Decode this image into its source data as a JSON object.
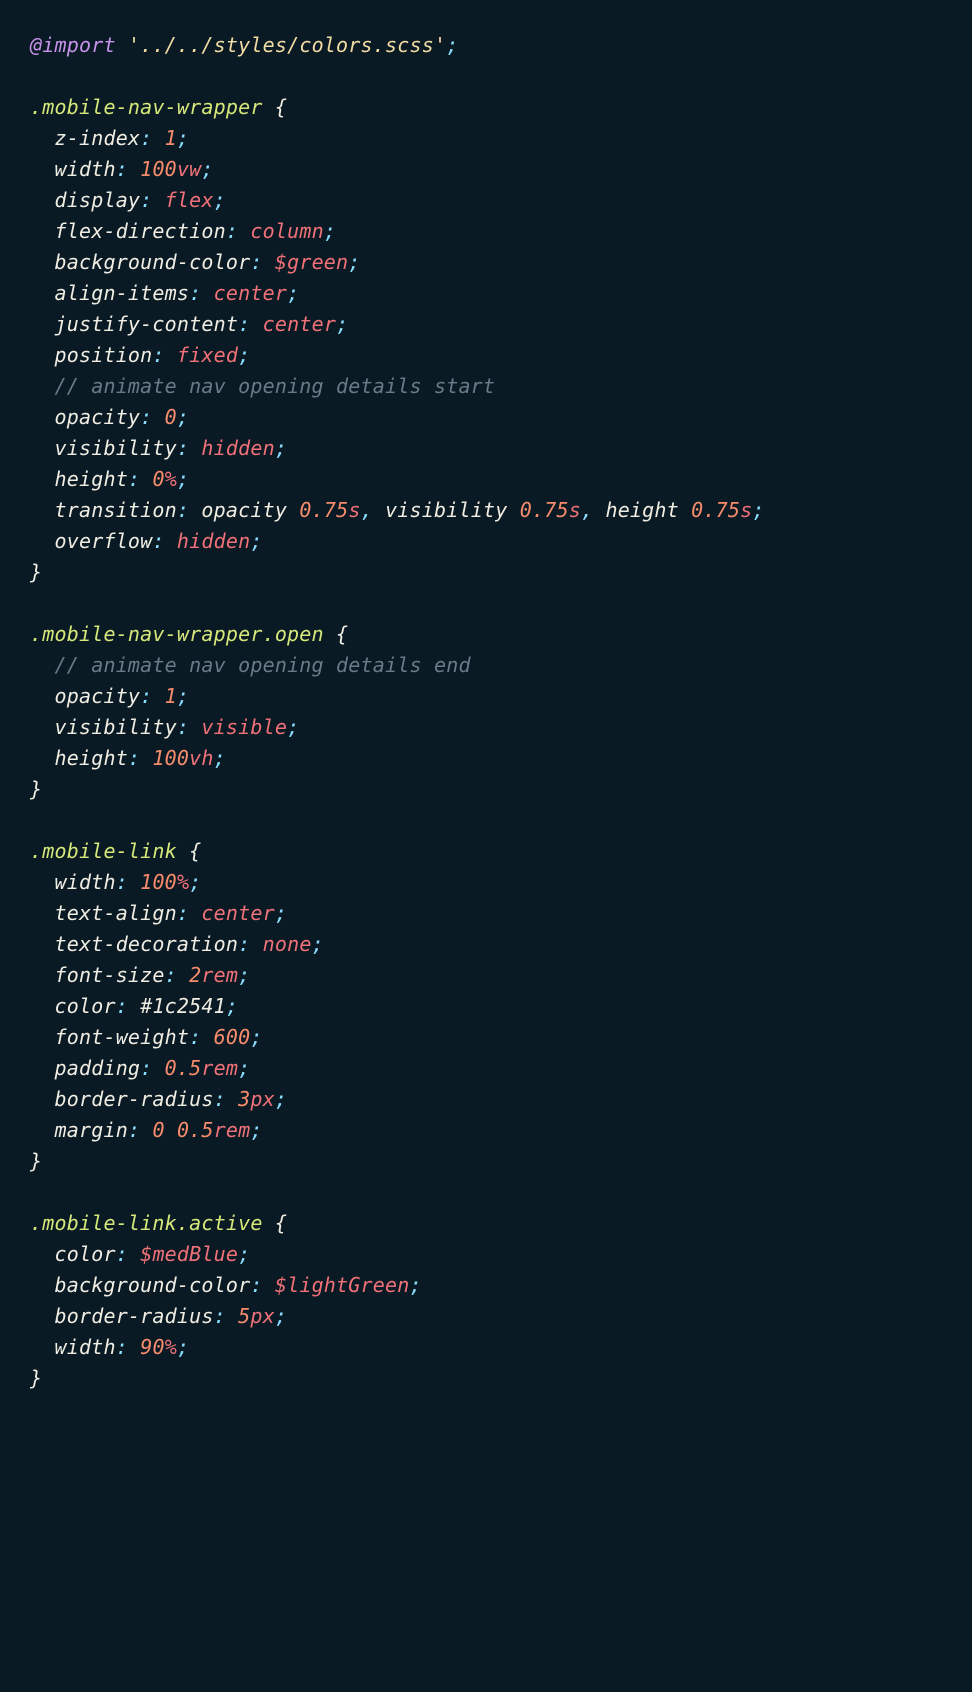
{
  "code": {
    "lines": [
      {
        "t": "import",
        "at": "@",
        "kw": "import",
        "str": "'../../styles/colors.scss'",
        "semi": ";"
      },
      {
        "t": "blank"
      },
      {
        "t": "sel",
        "sel": ".mobile-nav-wrapper",
        "brace": " {"
      },
      {
        "t": "decl",
        "prop": "z-index",
        "val": [
          {
            "num": "1"
          }
        ]
      },
      {
        "t": "decl",
        "prop": "width",
        "val": [
          {
            "num": "100",
            "unit": "vw"
          }
        ]
      },
      {
        "t": "decl",
        "prop": "display",
        "val": [
          {
            "v": "flex"
          }
        ]
      },
      {
        "t": "decl",
        "prop": "flex-direction",
        "val": [
          {
            "v": "column"
          }
        ]
      },
      {
        "t": "decl",
        "prop": "background-color",
        "val": [
          {
            "v": "$green"
          }
        ]
      },
      {
        "t": "decl",
        "prop": "align-items",
        "val": [
          {
            "v": "center"
          }
        ]
      },
      {
        "t": "decl",
        "prop": "justify-content",
        "val": [
          {
            "v": "center"
          }
        ]
      },
      {
        "t": "decl",
        "prop": "position",
        "val": [
          {
            "v": "fixed"
          }
        ]
      },
      {
        "t": "comment",
        "text": "// animate nav opening details start"
      },
      {
        "t": "decl",
        "prop": "opacity",
        "val": [
          {
            "num": "0"
          }
        ]
      },
      {
        "t": "decl",
        "prop": "visibility",
        "val": [
          {
            "v": "hidden"
          }
        ]
      },
      {
        "t": "decl",
        "prop": "height",
        "val": [
          {
            "num": "0",
            "unit": "%"
          }
        ]
      },
      {
        "t": "decl",
        "prop": "transition",
        "val": [
          {
            "f": "opacity"
          },
          {
            "sp": " "
          },
          {
            "num": "0.75",
            "unit": "s"
          },
          {
            "comma": ","
          },
          {
            "sp": " "
          },
          {
            "f": "visibility"
          },
          {
            "sp": " "
          },
          {
            "num": "0.75",
            "unit": "s"
          },
          {
            "comma": ","
          },
          {
            "sp": " "
          },
          {
            "f": "height"
          },
          {
            "sp": " "
          },
          {
            "num": "0.75",
            "unit": "s"
          }
        ]
      },
      {
        "t": "decl",
        "prop": "overflow",
        "val": [
          {
            "v": "hidden"
          }
        ]
      },
      {
        "t": "close",
        "brace": "}"
      },
      {
        "t": "blank"
      },
      {
        "t": "sel",
        "sel": ".mobile-nav-wrapper.open",
        "brace": " {"
      },
      {
        "t": "comment",
        "text": "// animate nav opening details end"
      },
      {
        "t": "decl",
        "prop": "opacity",
        "val": [
          {
            "num": "1"
          }
        ]
      },
      {
        "t": "decl",
        "prop": "visibility",
        "val": [
          {
            "v": "visible"
          }
        ]
      },
      {
        "t": "decl",
        "prop": "height",
        "val": [
          {
            "num": "100",
            "unit": "vh"
          }
        ]
      },
      {
        "t": "close",
        "brace": "}"
      },
      {
        "t": "blank"
      },
      {
        "t": "sel",
        "sel": ".mobile-link",
        "brace": " {"
      },
      {
        "t": "decl",
        "prop": "width",
        "val": [
          {
            "num": "100",
            "unit": "%"
          }
        ]
      },
      {
        "t": "decl",
        "prop": "text-align",
        "val": [
          {
            "v": "center"
          }
        ]
      },
      {
        "t": "decl",
        "prop": "text-decoration",
        "val": [
          {
            "v": "none"
          }
        ]
      },
      {
        "t": "decl",
        "prop": "font-size",
        "val": [
          {
            "num": "2",
            "unit": "rem"
          }
        ]
      },
      {
        "t": "decl",
        "prop": "color",
        "val": [
          {
            "hex": "#1c2541"
          }
        ]
      },
      {
        "t": "decl",
        "prop": "font-weight",
        "val": [
          {
            "num": "600"
          }
        ]
      },
      {
        "t": "decl",
        "prop": "padding",
        "val": [
          {
            "num": "0.5",
            "unit": "rem"
          }
        ]
      },
      {
        "t": "decl",
        "prop": "border-radius",
        "val": [
          {
            "num": "3",
            "unit": "px"
          }
        ]
      },
      {
        "t": "decl",
        "prop": "margin",
        "val": [
          {
            "num": "0"
          },
          {
            "sp": " "
          },
          {
            "num": "0.5",
            "unit": "rem"
          }
        ]
      },
      {
        "t": "close",
        "brace": "}"
      },
      {
        "t": "blank"
      },
      {
        "t": "sel",
        "sel": ".mobile-link.active",
        "brace": " {"
      },
      {
        "t": "decl",
        "prop": "color",
        "val": [
          {
            "v": "$medBlue"
          }
        ]
      },
      {
        "t": "decl",
        "prop": "background-color",
        "val": [
          {
            "v": "$lightGreen"
          }
        ]
      },
      {
        "t": "decl",
        "prop": "border-radius",
        "val": [
          {
            "num": "5",
            "unit": "px"
          }
        ]
      },
      {
        "t": "decl",
        "prop": "width",
        "val": [
          {
            "num": "90",
            "unit": "%"
          }
        ]
      },
      {
        "t": "close",
        "brace": "}"
      }
    ]
  }
}
